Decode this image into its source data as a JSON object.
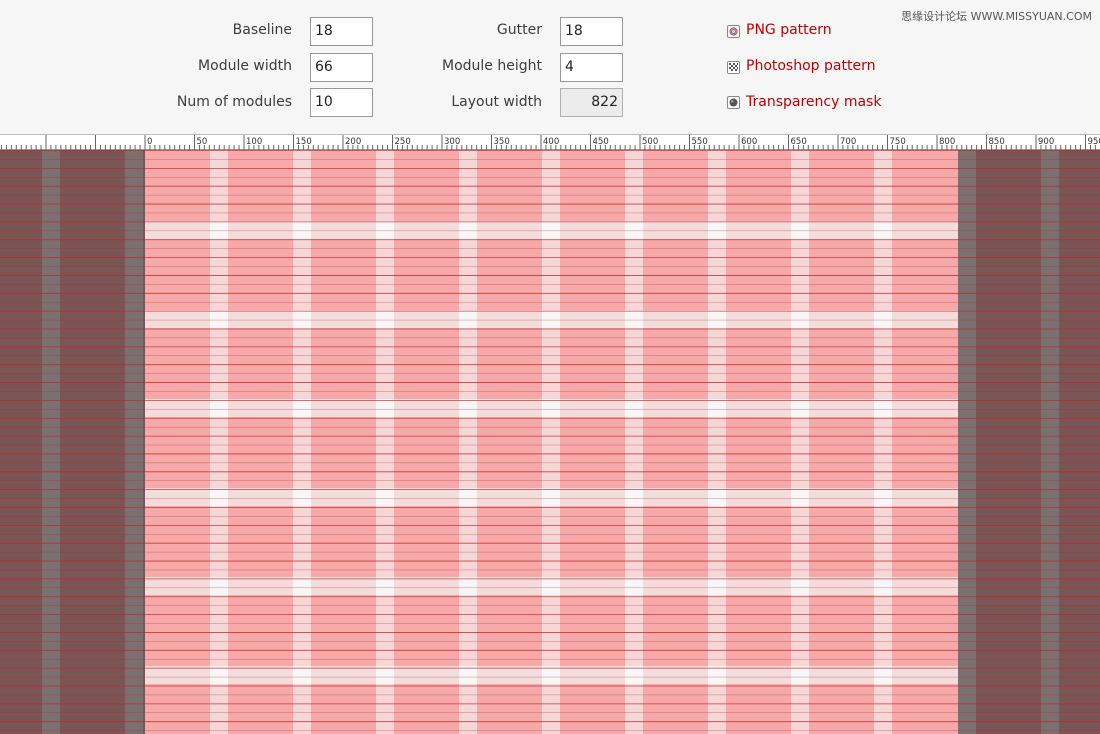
{
  "settings": {
    "baseline": {
      "label": "Baseline",
      "value": "18"
    },
    "gutter": {
      "label": "Gutter",
      "value": "18"
    },
    "module_width": {
      "label": "Module width",
      "value": "66"
    },
    "module_height": {
      "label": "Module height",
      "value": "4"
    },
    "num_modules": {
      "label": "Num of modules",
      "value": "10"
    },
    "layout_width": {
      "label": "Layout width",
      "value": "822"
    }
  },
  "downloads": {
    "png": {
      "label": "PNG pattern",
      "icon": "png-icon"
    },
    "photoshop": {
      "label": "Photoshop pattern",
      "icon": "checker-icon"
    },
    "mask": {
      "label": "Transparency mask",
      "icon": "mask-icon"
    }
  },
  "watermark": "思缘设计论坛 WWW.MISSYUAN.COM",
  "ruler": {
    "labels": [
      "0",
      "50",
      "100",
      "150",
      "200",
      "250",
      "300",
      "350",
      "400",
      "450",
      "500",
      "550",
      "600",
      "650",
      "700",
      "750",
      "800",
      "850",
      "900",
      "950"
    ]
  },
  "colors": {
    "column": "#f5a9a9",
    "gutter": "#f6d7d7",
    "module_gap": "#f3dcdc",
    "gap_cross": "#f7f7f7",
    "outside_column": "#7a5555",
    "outside_gutter": "#7b7070",
    "baseline": "#cc2020",
    "red_text": "#c00000"
  }
}
